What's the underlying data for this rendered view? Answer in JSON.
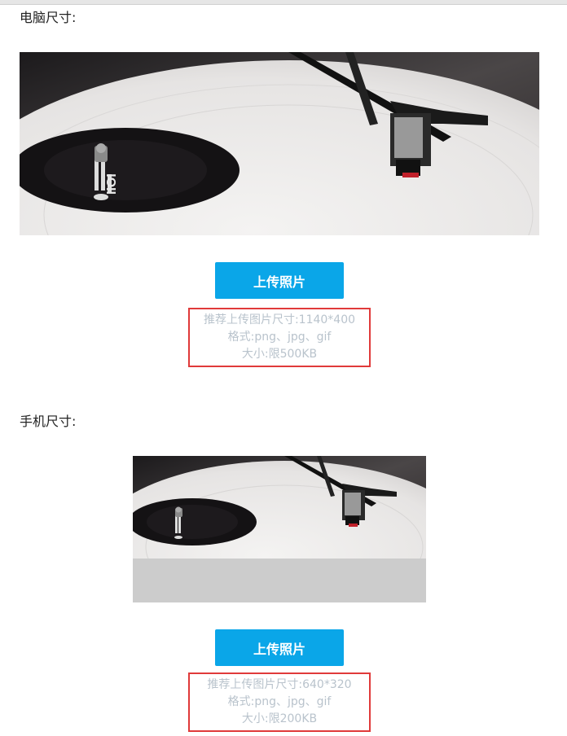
{
  "desktop": {
    "label": "电脑尺寸:",
    "upload_label": "上传照片",
    "hint_size": "推荐上传图片尺寸:1140*400",
    "hint_format": "格式:png、jpg、gif",
    "hint_limit": "大小:限500KB"
  },
  "mobile": {
    "label": "手机尺寸:",
    "upload_label": "上传照片",
    "hint_size": "推荐上传图片尺寸:640*320",
    "hint_format": "格式:png、jpg、gif",
    "hint_limit": "大小:限200KB"
  },
  "colors": {
    "button": "#0aa6e8",
    "hint_border": "#e03a3a",
    "hint_text": "#b9c3cc",
    "placeholder_fill": "#cccccc"
  },
  "record_label": {
    "line1": "IIOI",
    "line2": "IOII"
  }
}
